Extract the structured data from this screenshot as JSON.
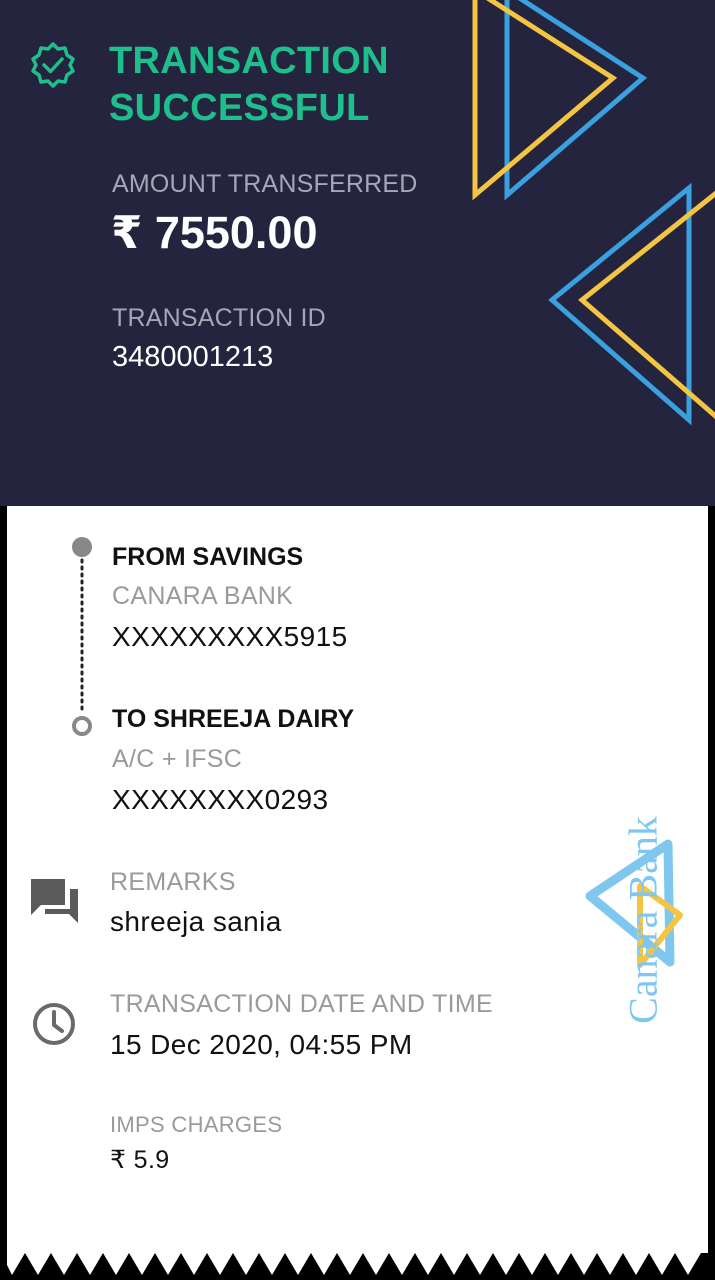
{
  "status": {
    "title": "TRANSACTION SUCCESSFUL"
  },
  "amount": {
    "label": "AMOUNT TRANSFERRED",
    "value": "₹ 7550.00"
  },
  "transaction": {
    "label": "TRANSACTION ID",
    "id": "3480001213"
  },
  "from": {
    "title": "FROM SAVINGS",
    "bank": "CANARA BANK",
    "account": "XXXXXXXXX5915"
  },
  "to": {
    "title": "TO SHREEJA DAIRY",
    "type": "A/C + IFSC",
    "account": "XXXXXXXX0293"
  },
  "remarks": {
    "label": "REMARKS",
    "value": "shreeja sania"
  },
  "datetime": {
    "label": "TRANSACTION DATE AND TIME",
    "value": "15 Dec 2020, 04:55 PM"
  },
  "charges": {
    "label": "IMPS CHARGES",
    "value": "₹ 5.9"
  },
  "watermark": {
    "text": "Canara Bank"
  },
  "colors": {
    "header_bg": "#24243f",
    "success": "#1fbf8d",
    "blue": "#3aa0e0",
    "yellow": "#f4c542"
  }
}
